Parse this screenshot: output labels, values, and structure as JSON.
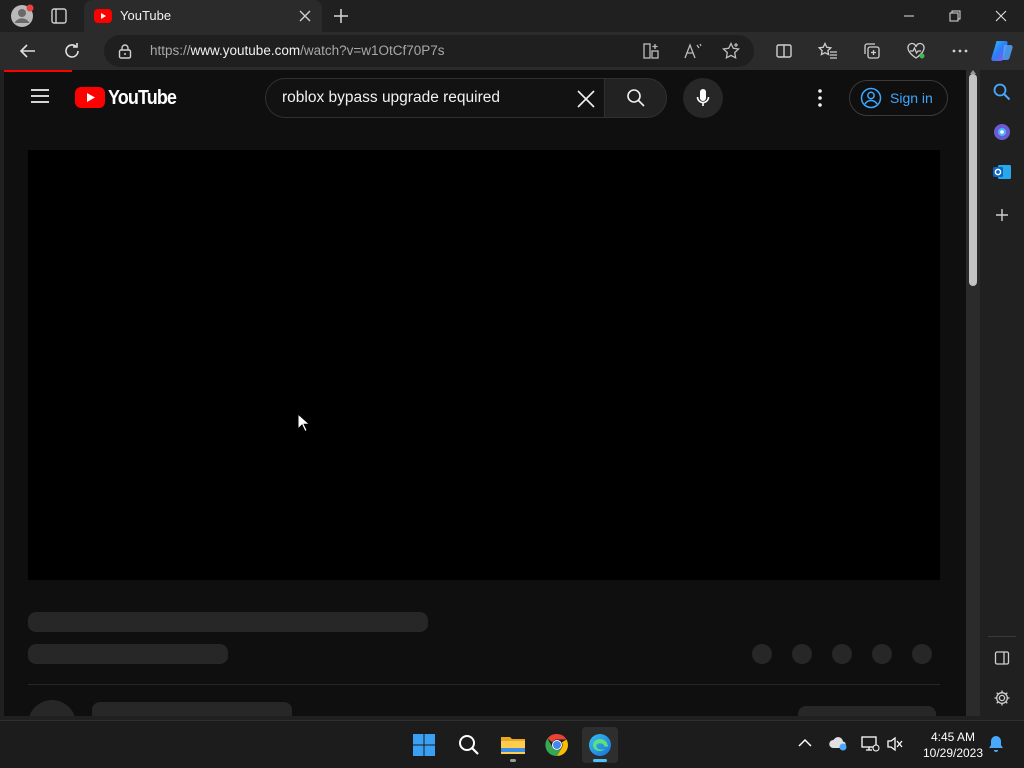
{
  "browser": {
    "tab_title": "YouTube",
    "url_prefix": "https://",
    "url_domain": "www.youtube.com",
    "url_path": "/watch?v=w1OtCf70P7s"
  },
  "youtube": {
    "logo_text": "YouTube",
    "search_query": "roblox bypass upgrade required",
    "sign_in_label": "Sign in",
    "accent_color": "#ff0000",
    "link_color": "#3ea6ff"
  },
  "taskbar": {
    "time": "4:45 AM",
    "date": "10/29/2023"
  }
}
